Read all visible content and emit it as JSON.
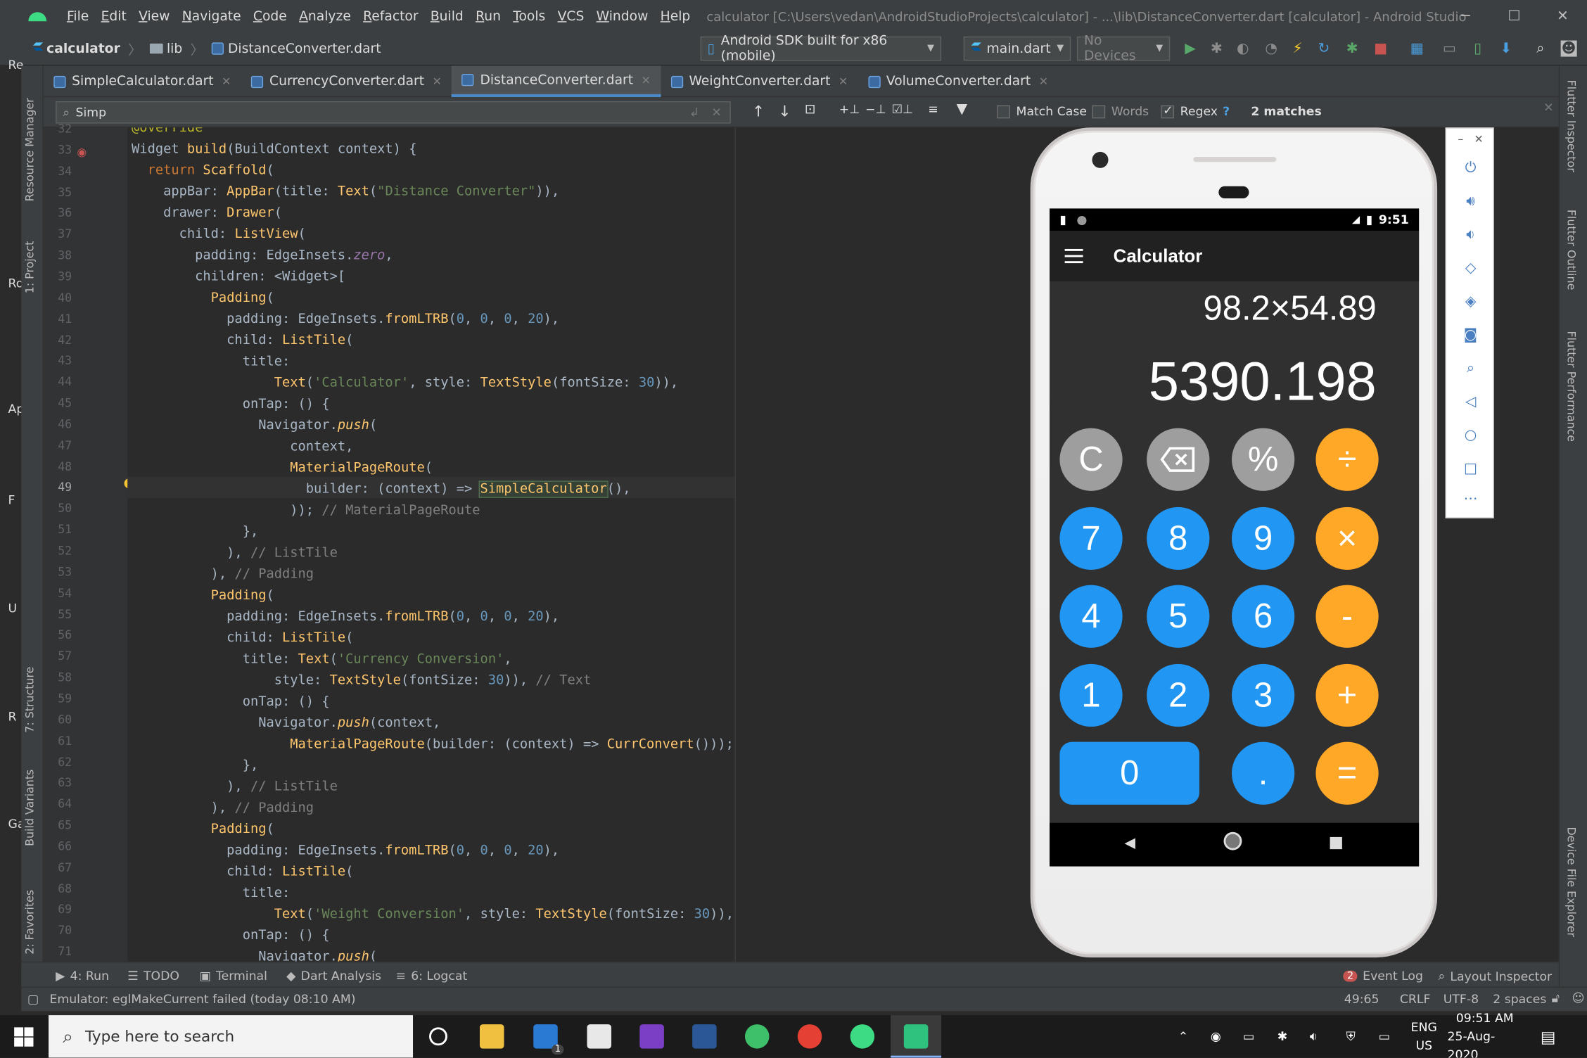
{
  "window": {
    "menu": [
      "File",
      "Edit",
      "View",
      "Navigate",
      "Code",
      "Analyze",
      "Refactor",
      "Build",
      "Run",
      "Tools",
      "VCS",
      "Window",
      "Help"
    ],
    "title": "calculator [C:\\Users\\vedan\\AndroidStudioProjects\\calculator] - ...\\lib\\DistanceConverter.dart [calculator] - Android Studio"
  },
  "navbar": {
    "project": "calculator",
    "folder": "lib",
    "file": "DistanceConverter.dart",
    "device": "Android SDK built for x86 (mobile)",
    "run_config": "main.dart",
    "devices": "No Devices"
  },
  "tabs": [
    {
      "label": "SimpleCalculator.dart"
    },
    {
      "label": "CurrencyConverter.dart"
    },
    {
      "label": "DistanceConverter.dart"
    },
    {
      "label": "WeightConverter.dart"
    },
    {
      "label": "VolumeConverter.dart"
    }
  ],
  "search": {
    "query": "Simp",
    "match_case": "Match Case",
    "words": "Words",
    "regex": "Regex",
    "help": "?",
    "matches": "2 matches"
  },
  "code": {
    "line_numbers": [
      "32",
      "33",
      "34",
      "35",
      "36",
      "37",
      "38",
      "39",
      "40",
      "41",
      "42",
      "43",
      "44",
      "45",
      "46",
      "47",
      "48",
      "49",
      "50",
      "51",
      "52",
      "53",
      "54",
      "55",
      "56",
      "57",
      "58",
      "59",
      "60",
      "61",
      "62",
      "63",
      "64",
      "65",
      "66",
      "67",
      "68",
      "69",
      "70",
      "71"
    ]
  },
  "left_tools": [
    "Resource Manager",
    "1: Project",
    "7: Structure",
    "Build Variants",
    "2: Favorites"
  ],
  "left_letters": [
    "Re",
    "Ro",
    "Ap",
    "F",
    "U",
    "R",
    "Ga"
  ],
  "right_tools": [
    "Flutter Inspector",
    "Flutter Outline",
    "Flutter Performance",
    "Device File Explorer"
  ],
  "phone": {
    "time": "9:51",
    "app_title": "Calculator",
    "expression": "98.2×54.89",
    "result": "5390.198",
    "keys": {
      "clear": "C",
      "percent": "%",
      "divide": "÷",
      "seven": "7",
      "eight": "8",
      "nine": "9",
      "multiply": "×",
      "four": "4",
      "five": "5",
      "six": "6",
      "minus": "-",
      "one": "1",
      "two": "2",
      "three": "3",
      "plus": "+",
      "zero": "0",
      "dot": ".",
      "equals": "="
    }
  },
  "toolwindows": {
    "run": "4: Run",
    "todo": "TODO",
    "terminal": "Terminal",
    "dart": "Dart Analysis",
    "logcat": "6: Logcat",
    "event_count": "2",
    "event_log": "Event Log",
    "layout_inspector": "Layout Inspector"
  },
  "status": {
    "message": "Emulator: eglMakeCurrent failed (today 08:10 AM)",
    "position": "49:65",
    "line_sep": "CRLF",
    "encoding": "UTF-8",
    "indent": "2 spaces"
  },
  "taskbar": {
    "search_placeholder": "Type here to search",
    "mail_badge": "1",
    "lang": "ENG",
    "region": "US",
    "time": "09:51 AM",
    "date": "25-Aug-2020"
  },
  "colors": {
    "accent_blue": "#2196f3",
    "accent_orange": "#ffa726",
    "key_grey": "#9e9e9e"
  }
}
